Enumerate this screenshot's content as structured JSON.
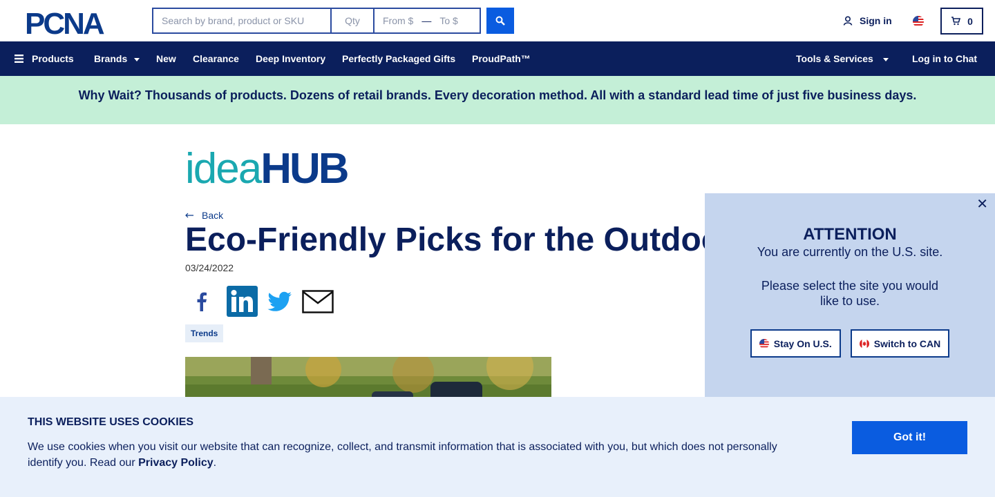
{
  "header": {
    "logo_text": "PCNA",
    "search_placeholder": "Search by brand, product or SKU",
    "qty_placeholder": "Qty",
    "from_placeholder": "From $",
    "to_placeholder": "To $",
    "signin_label": "Sign in",
    "cart_count": "0"
  },
  "nav": {
    "products": "Products",
    "brands": "Brands",
    "new": "New",
    "clearance": "Clearance",
    "deep_inventory": "Deep Inventory",
    "gifts": "Perfectly Packaged Gifts",
    "proudpath": "ProudPath™",
    "tools": "Tools & Services",
    "chat": "Log in to Chat"
  },
  "banner": {
    "text": "Why Wait? Thousands of products. Dozens of retail brands. Every decoration method. All with a standard lead time of just five business days."
  },
  "article": {
    "brand_idea": "idea",
    "brand_hub": "HUB",
    "back_label": "Back",
    "title": "Eco-Friendly Picks for the Outdoors",
    "date": "03/24/2022",
    "tag": "Trends"
  },
  "popup": {
    "heading": "ATTENTION",
    "line1": "You are currently on the U.S. site.",
    "line2": "Please select the site you would like to use.",
    "stay_label": "Stay On U.S.",
    "switch_label": "Switch to CAN"
  },
  "cookie": {
    "heading": "THIS WEBSITE USES COOKIES",
    "text": "We use cookies when you visit our website that can recognize, collect, and transmit information that is associated with you, but which does not personally identify you. Read our ",
    "link": "Privacy Policy",
    "suffix": ".",
    "button": "Got it!"
  },
  "colors": {
    "navy": "#0b1f5c",
    "accent": "#0a5ce0",
    "banner": "#c4efd7",
    "popup": "#c5d5ee"
  }
}
